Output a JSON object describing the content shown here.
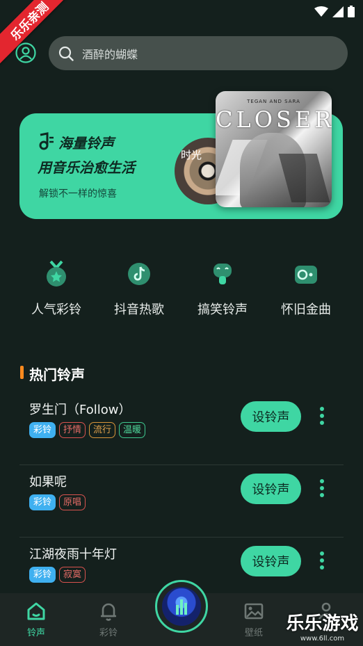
{
  "watermark_badge": "乐乐亲测",
  "search": {
    "placeholder": "酒醉的蝴蝶"
  },
  "banner": {
    "title_line1": "海量铃声",
    "title_line2": "用音乐治愈生活",
    "subtitle": "解锁不一样的惊喜",
    "disc_text": "时光",
    "album_artist": "TEGAN AND SARA",
    "album_title": "CLOSER"
  },
  "categories": [
    {
      "label": "人气彩铃",
      "icon": "star-medal-icon"
    },
    {
      "label": "抖音热歌",
      "icon": "tiktok-icon"
    },
    {
      "label": "搞笑铃声",
      "icon": "funny-face-icon"
    },
    {
      "label": "怀旧金曲",
      "icon": "cassette-icon"
    }
  ],
  "hot": {
    "title": "热门铃声",
    "set_label": "设铃声",
    "songs": [
      {
        "title": "罗生门（Follow）",
        "tags": [
          "彩铃",
          "抒情",
          "流行",
          "温暖"
        ]
      },
      {
        "title": "如果呢",
        "tags": [
          "彩铃",
          "原唱"
        ]
      },
      {
        "title": "江湖夜雨十年灯",
        "tags": [
          "彩铃",
          "寂寞"
        ]
      }
    ]
  },
  "nav": {
    "items": [
      {
        "label": "铃声",
        "icon": "home-icon",
        "active": true
      },
      {
        "label": "彩铃",
        "icon": "bell-icon",
        "active": false
      },
      {
        "label": "壁纸",
        "icon": "image-icon",
        "active": false
      },
      {
        "label": "",
        "icon": "user-icon",
        "active": false
      }
    ]
  },
  "site_watermark": {
    "name": "乐乐游戏",
    "url": "www.6ll.com"
  },
  "colors": {
    "accent": "#3fd6a3",
    "background": "#14201d",
    "hot_bar": "#ff8a1e",
    "tag_blue": "#3fb0f0"
  }
}
